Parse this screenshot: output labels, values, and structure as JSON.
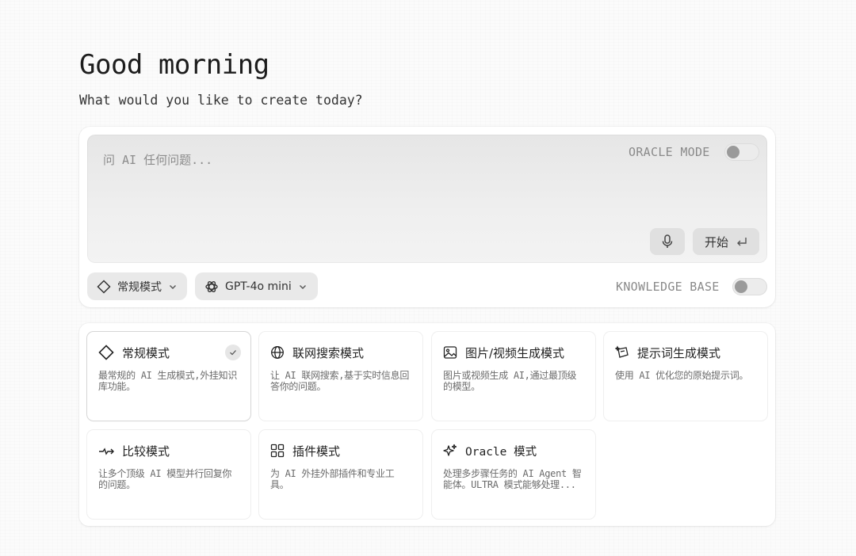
{
  "header": {
    "greeting": "Good morning",
    "subtitle": "What would you like to create today?"
  },
  "composer": {
    "placeholder": "问 AI 任何问题...",
    "value": "",
    "oracle_mode_label": "ORACLE MODE",
    "oracle_mode_on": false,
    "mic_icon": "microphone-icon",
    "start_label": "开始",
    "start_icon": "enter-return-icon"
  },
  "toolbar": {
    "mode_selector": {
      "label": "常规模式",
      "icon": "diamond-icon"
    },
    "model_selector": {
      "label": "GPT-4o mini",
      "icon": "openai-logo-icon"
    },
    "knowledge_base_label": "KNOWLEDGE BASE",
    "knowledge_base_on": false
  },
  "modes": [
    {
      "title": "常规模式",
      "desc": "最常规的 AI 生成模式,外挂知识库功能。",
      "icon": "diamond-icon",
      "selected": true
    },
    {
      "title": "联网搜索模式",
      "desc": "让 AI 联网搜索,基于实时信息回答你的问题。",
      "icon": "globe-icon",
      "selected": false
    },
    {
      "title": "图片/视频生成模式",
      "desc": "图片或视频生成 AI,通过最顶级的模型。",
      "icon": "image-icon",
      "selected": false
    },
    {
      "title": "提示词生成模式",
      "desc": "使用 AI 优化您的原始提示词。",
      "icon": "prompt-sparkle-icon",
      "selected": false
    },
    {
      "title": "比较模式",
      "desc": "让多个顶级 AI 模型并行回复你的问题。",
      "icon": "compare-icon",
      "selected": false
    },
    {
      "title": "插件模式",
      "desc": "为 AI 外挂外部插件和专业工具。",
      "icon": "grid-icon",
      "selected": false
    },
    {
      "title": "Oracle 模式",
      "desc": "处理多步骤任务的 AI Agent 智能体。ULTRA 模式能够处理...",
      "icon": "sparkles-icon",
      "selected": false
    }
  ]
}
